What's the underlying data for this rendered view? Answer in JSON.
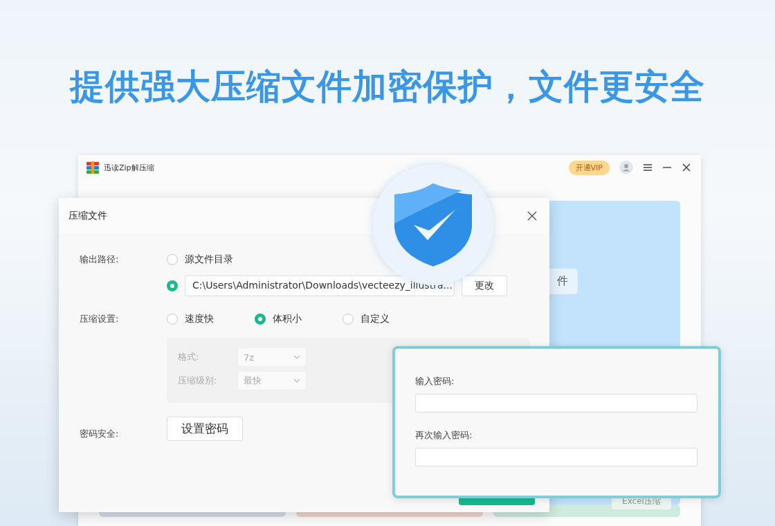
{
  "headline": "提供强大压缩文件加密保护，文件更安全",
  "app_window": {
    "title": "迅读Zip解压缩",
    "vip_button": "开通VIP",
    "partial_button": "件",
    "excel_button": "Excel压缩"
  },
  "compress_dialog": {
    "title": "压缩文件",
    "output_path": {
      "label": "输出路径:",
      "options": [
        {
          "kind": "source",
          "label": "源文件目录",
          "selected": false
        },
        {
          "kind": "custom",
          "value": "C:\\Users\\Administrator\\Downloads\\vecteezy_illustra...",
          "selected": true
        }
      ],
      "button": "更改"
    },
    "compression": {
      "label": "压缩设置:",
      "options": [
        {
          "label": "速度快",
          "selected": false
        },
        {
          "label": "体积小",
          "selected": true
        },
        {
          "label": "自定义",
          "selected": false
        }
      ],
      "advanced_disabled": true,
      "format": {
        "label": "格式:",
        "value": "7z"
      },
      "level": {
        "label": "压缩级别:",
        "value": "最快"
      }
    },
    "password": {
      "label": "密码安全:",
      "button": "设置密码"
    }
  },
  "password_dialog": {
    "fields": [
      {
        "label": "输入密码:"
      },
      {
        "label": "再次输入密码:"
      }
    ]
  }
}
